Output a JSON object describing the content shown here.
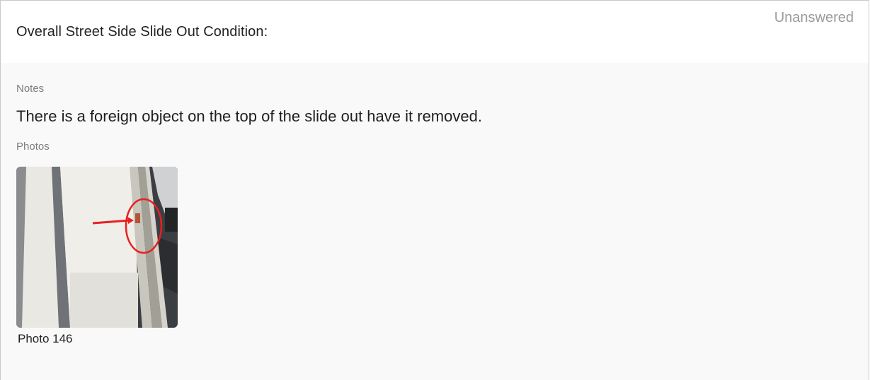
{
  "header": {
    "title": "Overall Street Side Slide Out Condition:",
    "status": "Unanswered"
  },
  "notes": {
    "label": "Notes",
    "text": "There is a foreign object on the top of the slide out have it removed."
  },
  "photos": {
    "label": "Photos",
    "items": [
      {
        "caption": "Photo 146"
      }
    ]
  },
  "colors": {
    "annotation": "#e8201f",
    "status": "#9a9a9a"
  }
}
